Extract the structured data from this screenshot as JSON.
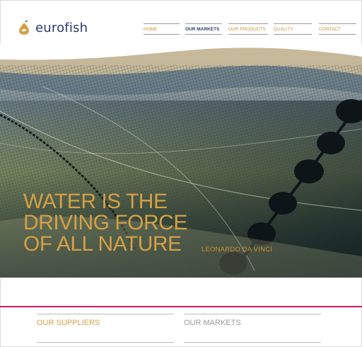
{
  "brand": {
    "name": "eurofish",
    "colors": {
      "accent": "#d4a046",
      "navy": "#2a3b6e",
      "divider": "#d6156e"
    }
  },
  "nav": {
    "items": [
      {
        "label": "HOME",
        "active": false
      },
      {
        "label": "OUR MARKETS",
        "active": true
      },
      {
        "label": "OUR PRODUCTS",
        "active": false
      },
      {
        "label": "QUALITY",
        "active": false
      },
      {
        "label": "CONTACT",
        "active": false
      }
    ]
  },
  "hero": {
    "quote_lines": [
      "WATER IS THE",
      "DRIVING FORCE",
      "OF ALL NATURE"
    ],
    "quote_author": "LEONARDO DA VINCI"
  },
  "sections": [
    {
      "title": "OUR SUPPLIERS"
    },
    {
      "title": "OUR MARKETS"
    }
  ]
}
